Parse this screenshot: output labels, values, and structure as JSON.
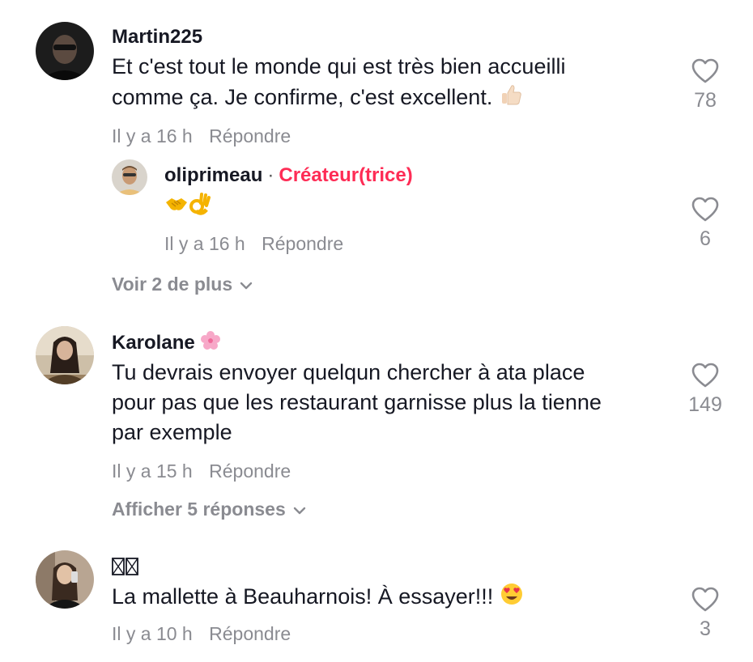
{
  "comments": [
    {
      "username": "Martin225",
      "text_line1": "Et c'est tout le monde qui est très bien accueilli",
      "text_line2": "comme ça. Je confirme, c'est excellent.",
      "time": "Il y a 16 h",
      "reply_label": "Répondre",
      "likes": "78"
    },
    {
      "username": "Karolane",
      "text_line1": "Tu devrais envoyer quelqun chercher à ata place",
      "text_line2": "pour pas que les restaurant garnisse plus la tienne",
      "text_line3": "par exemple",
      "time": "Il y a 15 h",
      "reply_label": "Répondre",
      "likes": "149",
      "more_label": "Afficher 5 réponses"
    },
    {
      "username": "",
      "text": "La mallette à Beauharnois! À essayer!!!",
      "time": "Il y a 10 h",
      "reply_label": "Répondre",
      "likes": "3"
    }
  ],
  "reply": {
    "username": "oliprimeau",
    "separator": "·",
    "creator_badge": "Créateur(trice)",
    "time": "Il y a 16 h",
    "reply_label": "Répondre",
    "likes": "6"
  },
  "thread1_more_label": "Voir 2 de plus",
  "icons": {
    "like": "heart-outline-icon",
    "expand": "chevron-down-icon",
    "thumbs_up": "thumbs-up-emoji",
    "handshake": "handshake-emoji",
    "ok_hand": "ok-hand-emoji",
    "flower": "cherry-blossom-emoji",
    "heart_eyes": "heart-eyes-emoji",
    "missing_glyph": "missing-glyph-icon"
  },
  "colors": {
    "text": "#161823",
    "muted": "#8a8b91",
    "creator": "#fe2c55"
  }
}
